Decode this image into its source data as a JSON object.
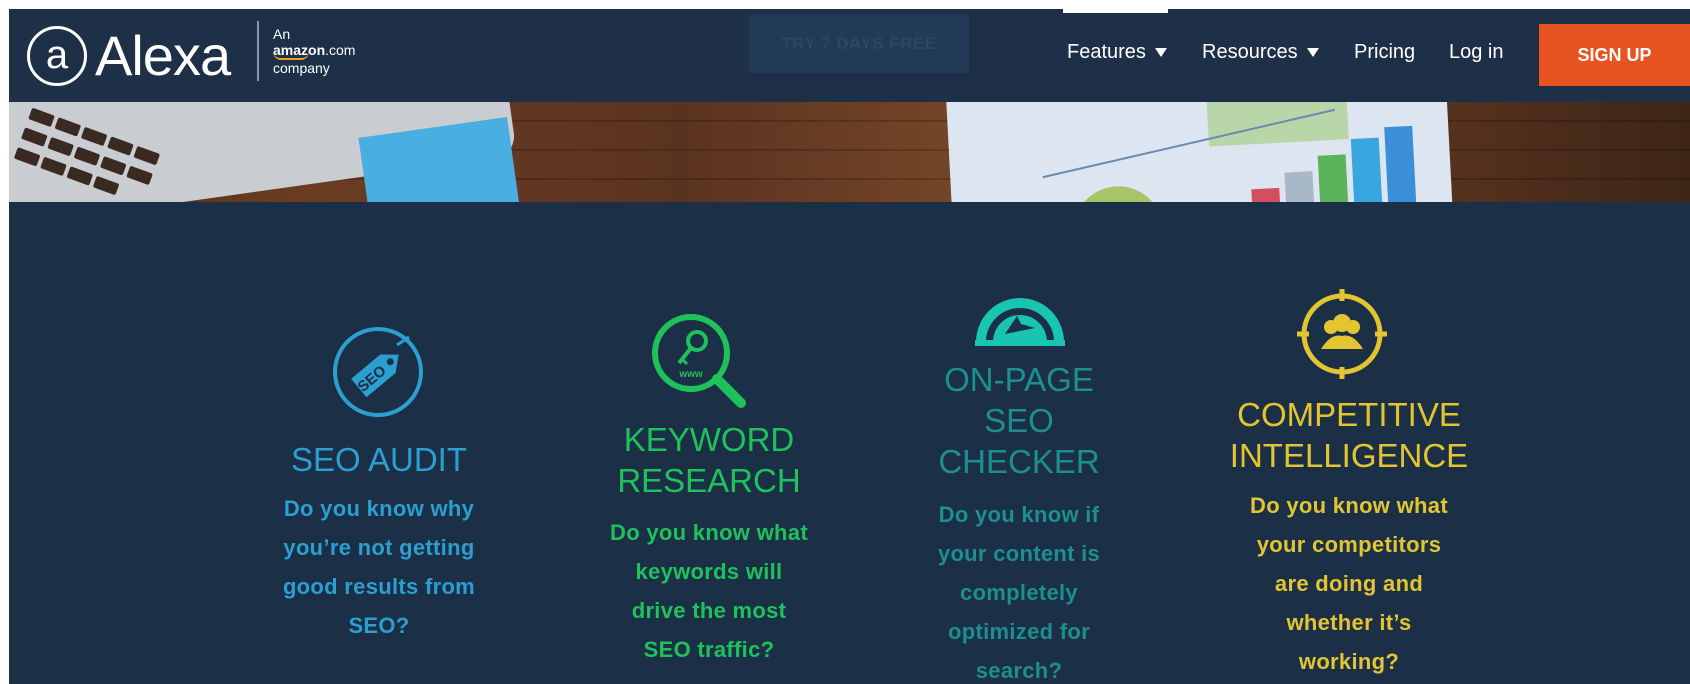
{
  "header": {
    "brand": {
      "name": "Alexa",
      "at_symbol": "a",
      "sub_line1": "An",
      "sub_amazon": "amazon",
      "sub_com": ".com",
      "sub_line3": "company"
    },
    "ghost_button": "TRY 7 DAYS FREE",
    "nav": [
      {
        "label": "Features",
        "has_dropdown": true,
        "active": true
      },
      {
        "label": "Resources",
        "has_dropdown": true,
        "active": false
      },
      {
        "label": "Pricing",
        "has_dropdown": false,
        "active": false
      },
      {
        "label": "Log in",
        "has_dropdown": false,
        "active": false
      }
    ],
    "signup_label": "SIGN UP"
  },
  "features": [
    {
      "icon": "seo-tag-icon",
      "title_lines": [
        "SEO AUDIT"
      ],
      "desc_lines": [
        "Do you know why",
        "you’re not getting",
        "good results from",
        "SEO?"
      ],
      "color": "#2a9fd0",
      "icon_text": "SEO"
    },
    {
      "icon": "keyword-magnifier-icon",
      "title_lines": [
        "KEYWORD",
        "RESEARCH"
      ],
      "desc_lines": [
        "Do you know what",
        "keywords will",
        "drive the most",
        "SEO traffic?"
      ],
      "color": "#1fc25a",
      "icon_text": "www"
    },
    {
      "icon": "gauge-icon",
      "title_lines": [
        "ON-PAGE",
        "SEO",
        "CHECKER"
      ],
      "desc_lines": [
        "Do you know if",
        "your content is",
        "completely",
        "optimized for",
        "search?"
      ],
      "color": "#1d8f8c",
      "icon_color": "#19c4b0"
    },
    {
      "icon": "target-people-icon",
      "title_lines": [
        "COMPETITIVE",
        "INTELLIGENCE"
      ],
      "desc_lines": [
        "Do you know what",
        "your competitors",
        "are doing and",
        "whether it’s",
        "working?"
      ],
      "color": "#e3c531"
    }
  ],
  "colors": {
    "header_bg": "#1d3048",
    "page_bg": "#1b2f47",
    "signup_bg": "#e8541f"
  }
}
